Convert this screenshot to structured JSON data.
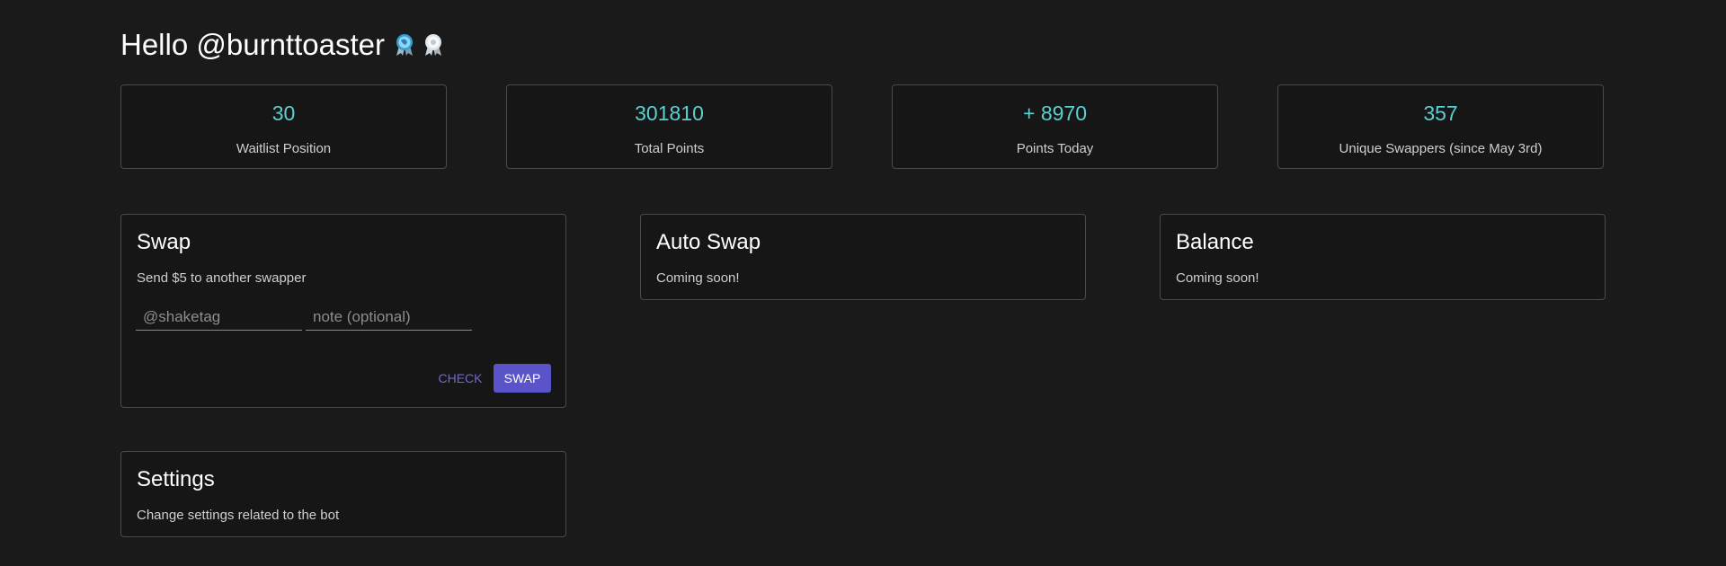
{
  "greeting": {
    "text": "Hello @burnttoaster",
    "badges": [
      "globe-ribbon-badge-icon",
      "white-ribbon-badge-icon"
    ]
  },
  "stats": [
    {
      "value": "30",
      "label": "Waitlist Position"
    },
    {
      "value": "301810",
      "label": "Total Points"
    },
    {
      "value": "+ 8970",
      "label": "Points Today"
    },
    {
      "value": "357",
      "label": "Unique Swappers (since May 3rd)"
    }
  ],
  "swap": {
    "title": "Swap",
    "description": "Send $5 to another swapper",
    "shaketag_placeholder": "@shaketag",
    "note_placeholder": "note (optional)",
    "check_label": "CHECK",
    "swap_label": "SWAP"
  },
  "auto_swap": {
    "title": "Auto Swap",
    "description": "Coming soon!"
  },
  "balance": {
    "title": "Balance",
    "description": "Coming soon!"
  },
  "settings": {
    "title": "Settings",
    "description": "Change settings related to the bot"
  },
  "colors": {
    "background": "#1a1a1a",
    "card_border": "#4a4a4a",
    "stat_value": "#5ccfcf",
    "accent": "#5b54c9"
  }
}
